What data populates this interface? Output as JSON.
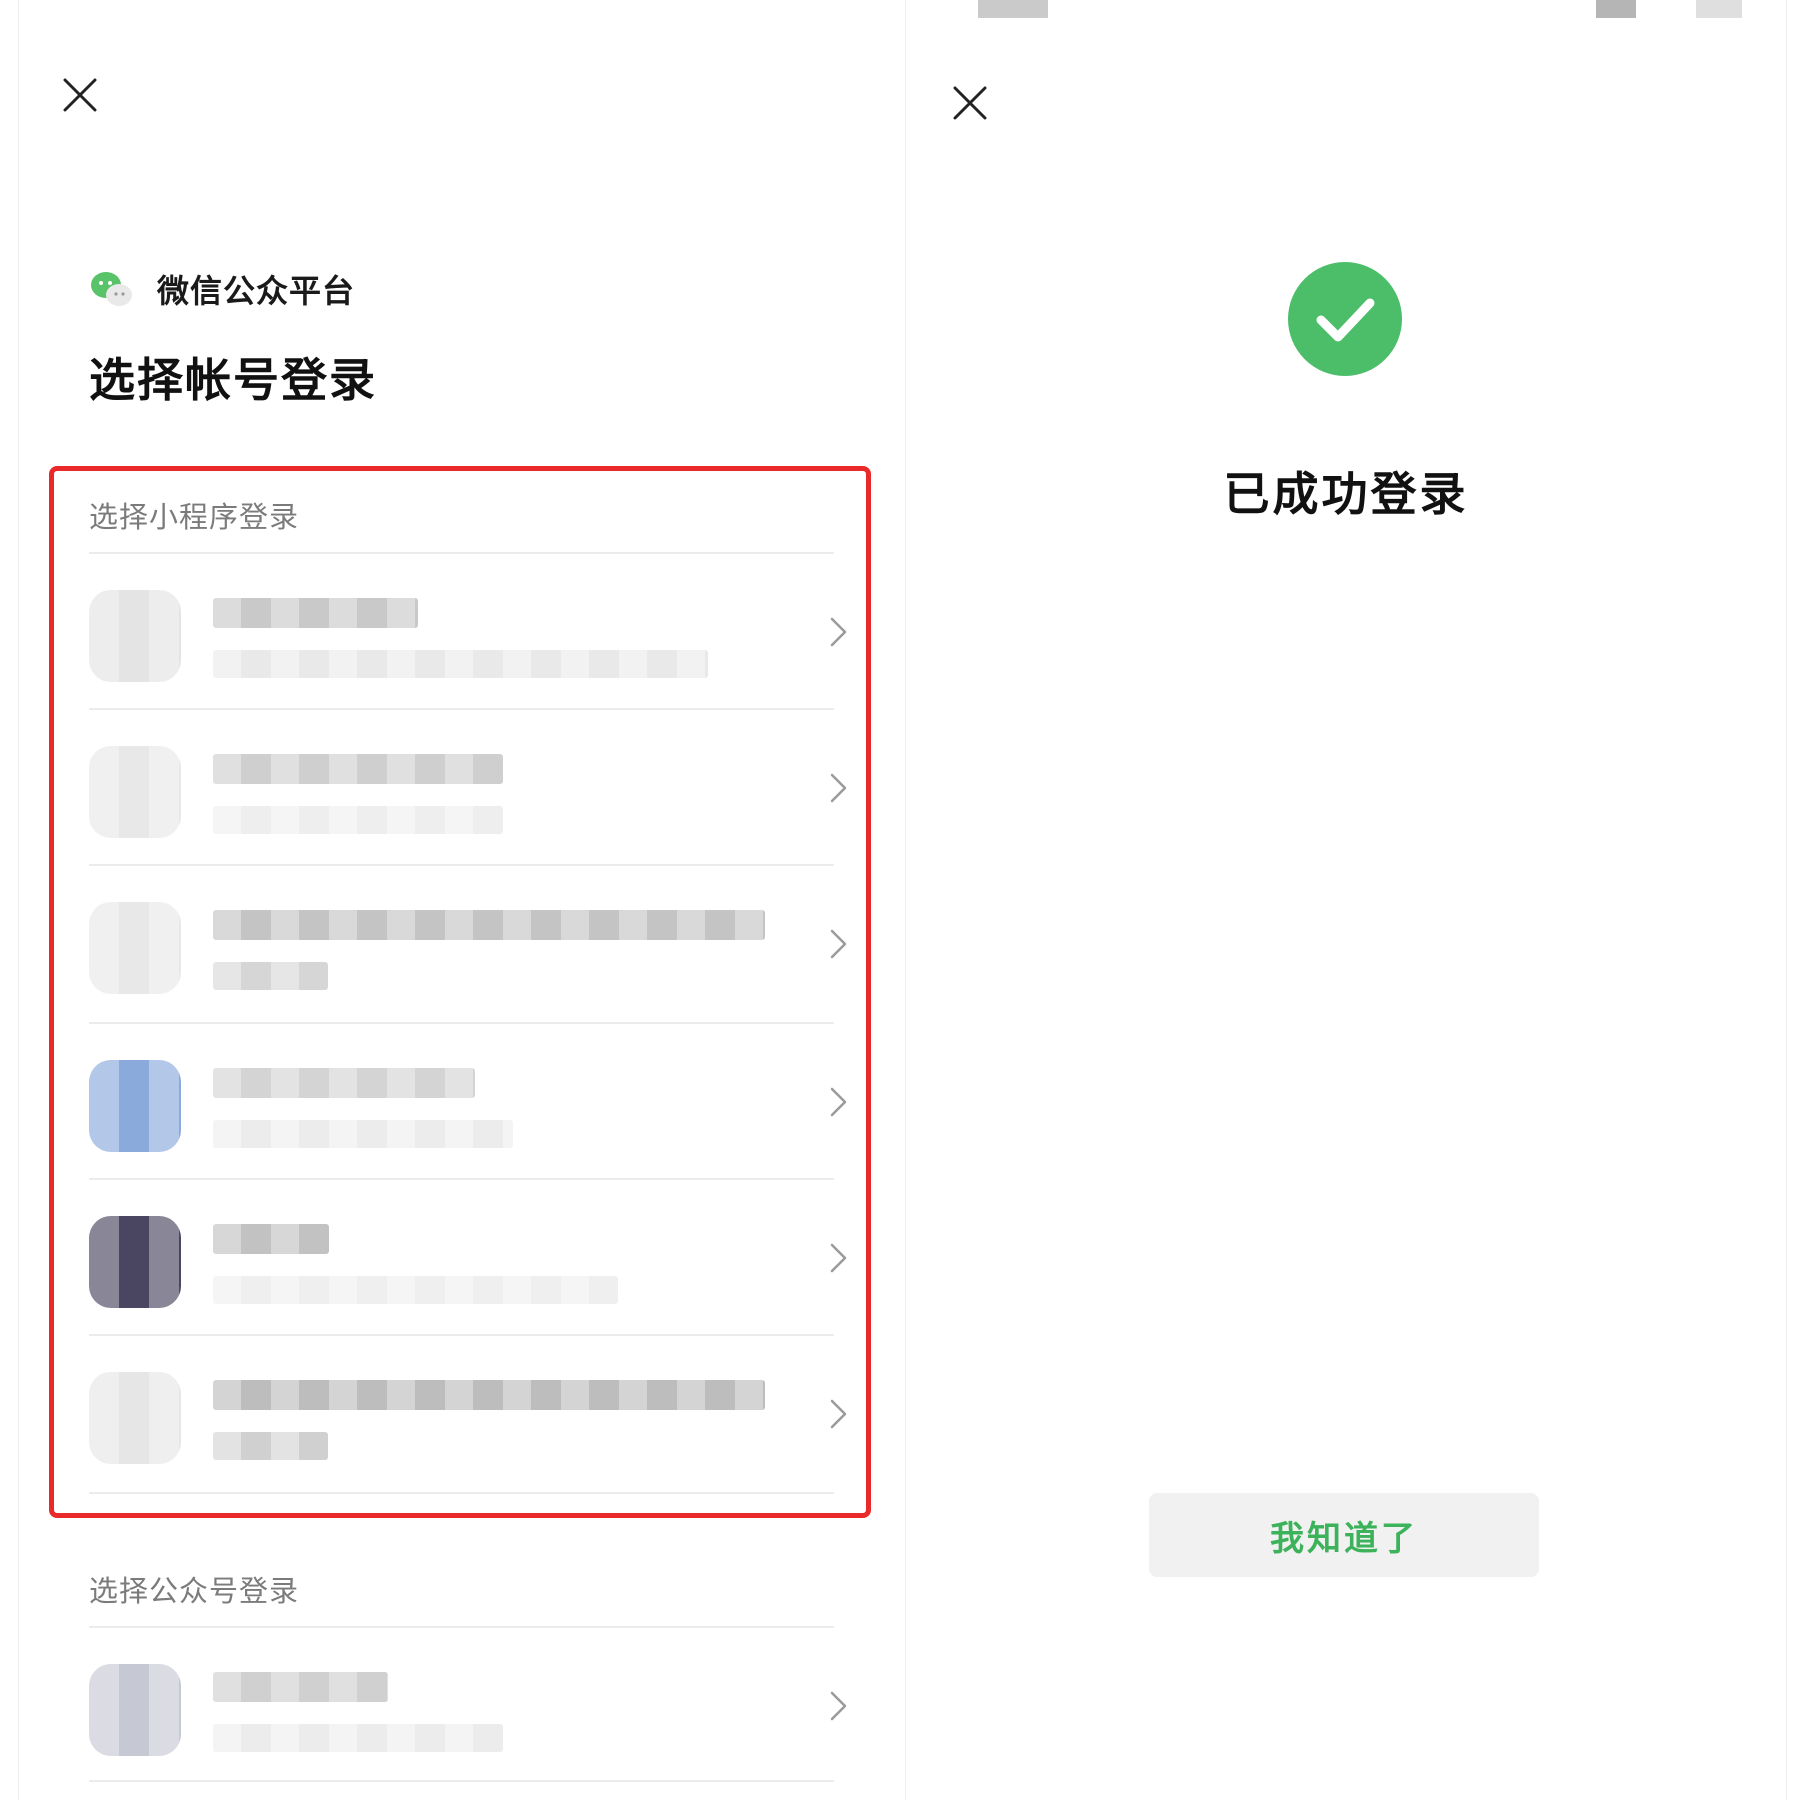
{
  "left_screen": {
    "brand_name": "微信公众平台",
    "title": "选择帐号登录",
    "mini_program_section": {
      "label": "选择小程序登录",
      "accounts": [
        {
          "avatar_color": "#e4e4e4",
          "name_color": "#c9c9c9",
          "sub_color": "#e9e9e9"
        },
        {
          "avatar_color": "#e8e8e8",
          "name_color": "#cfcfcf",
          "sub_color": "#eeeeee"
        },
        {
          "avatar_color": "#e8e8e8",
          "name_color": "#c4c4c4",
          "sub_color": "#d6d6d6"
        },
        {
          "avatar_color": "#8aaadb",
          "name_color": "#d4d4d4",
          "sub_color": "#ececec"
        },
        {
          "avatar_color": "#4a4560",
          "name_color": "#c2c2c2",
          "sub_color": "#efefef"
        },
        {
          "avatar_color": "#e6e6e6",
          "name_color": "#bdbdbd",
          "sub_color": "#d0d0d0"
        }
      ]
    },
    "official_account_section": {
      "label": "选择公众号登录",
      "accounts": [
        {
          "avatar_color": "#c6c8d4",
          "name_color": "#d0d0d0",
          "sub_color": "#ececec"
        }
      ]
    }
  },
  "right_screen": {
    "title": "已成功登录",
    "button_label": "我知道了"
  },
  "colors": {
    "accent_green": "#3cb35a",
    "success_circle": "#4cbe6a",
    "highlight_red": "#ea2a2a"
  },
  "icons": [
    "close-icon",
    "wechat-logo-icon",
    "chevron-right-icon",
    "success-check-icon"
  ]
}
